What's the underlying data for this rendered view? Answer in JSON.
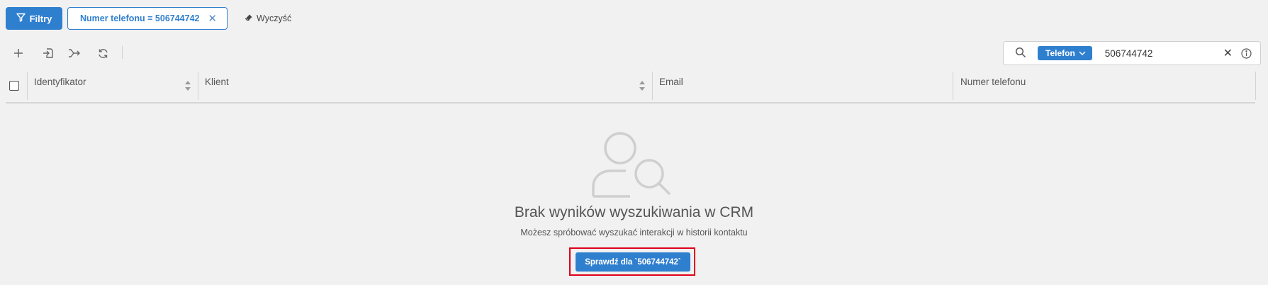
{
  "filters_bar": {
    "filters_label": "Filtry",
    "chip_label": "Numer telefonu = 506744742",
    "clear_label": "Wyczyść"
  },
  "toolbar": {
    "icons": [
      "plus-icon",
      "import-icon",
      "merge-icon",
      "refresh-icon"
    ]
  },
  "search": {
    "type_label": "Telefon",
    "value": "506744742"
  },
  "table": {
    "columns": [
      "Identyfikator",
      "Klient",
      "Email",
      "Numer telefonu"
    ]
  },
  "empty_state": {
    "title": "Brak wyników wyszukiwania w CRM",
    "subtitle": "Możesz spróbować wyszukać interakcji w historii kontaktu",
    "button_label": "Sprawdź dla `506744742`"
  },
  "colors": {
    "accent": "#2f7fcf",
    "background": "#f1f1f1",
    "highlight": "#e0001a"
  }
}
